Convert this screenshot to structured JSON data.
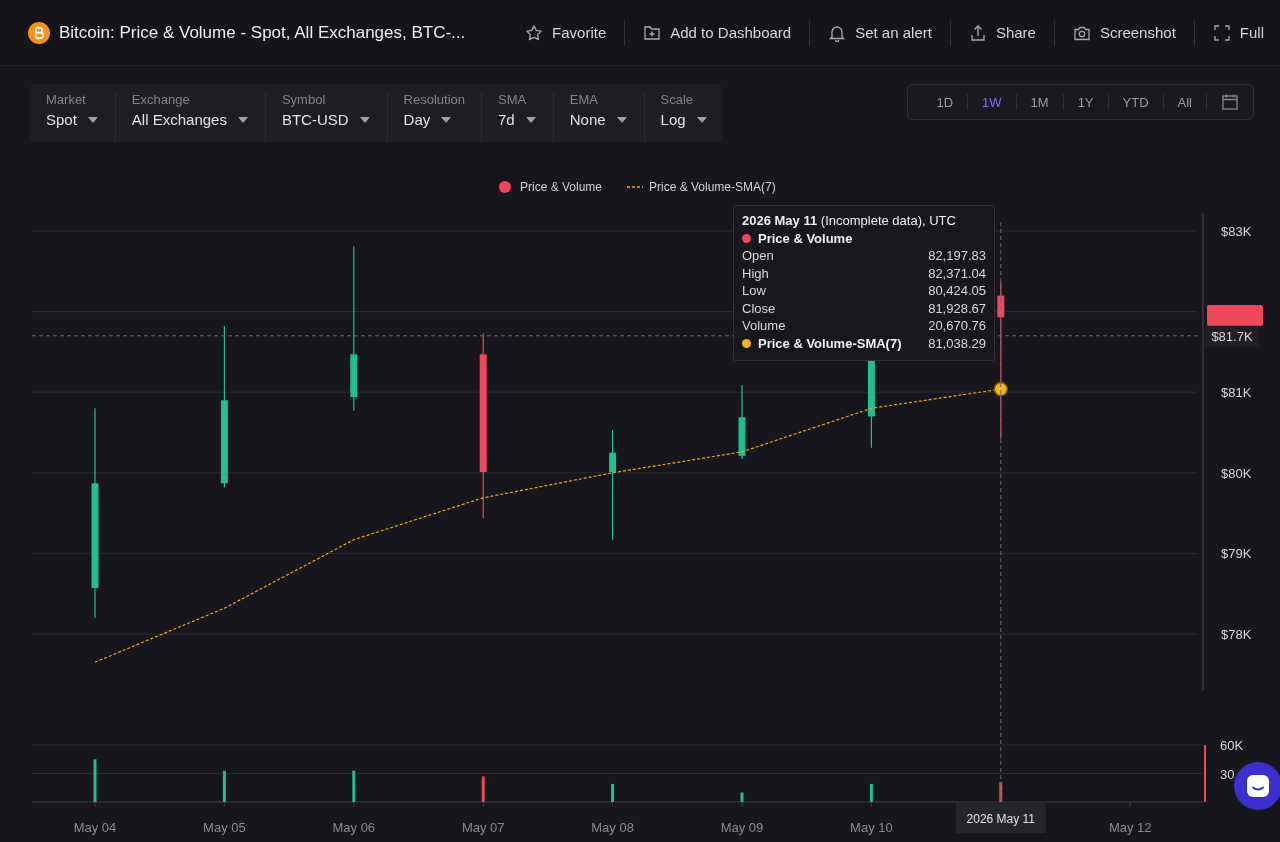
{
  "header": {
    "title": "Bitcoin: Price & Volume - Spot, All Exchanges, BTC-...",
    "actions": [
      {
        "kind": "star",
        "label": "Favorite"
      },
      {
        "kind": "dashboard",
        "label": "Add to Dashboard"
      },
      {
        "kind": "bell",
        "label": "Set an alert"
      },
      {
        "kind": "share",
        "label": "Share"
      },
      {
        "kind": "camera",
        "label": "Screenshot"
      },
      {
        "kind": "expand",
        "label": "Full"
      }
    ]
  },
  "filters": [
    {
      "label": "Market",
      "value": "Spot"
    },
    {
      "label": "Exchange",
      "value": "All Exchanges"
    },
    {
      "label": "Symbol",
      "value": "BTC-USD"
    },
    {
      "label": "Resolution",
      "value": "Day"
    },
    {
      "label": "SMA",
      "value": "7d"
    },
    {
      "label": "EMA",
      "value": "None"
    },
    {
      "label": "Scale",
      "value": "Log"
    }
  ],
  "ranges": [
    {
      "label": "1D",
      "selected": false
    },
    {
      "label": "1W",
      "selected": true
    },
    {
      "label": "1M",
      "selected": false
    },
    {
      "label": "1Y",
      "selected": false
    },
    {
      "label": "YTD",
      "selected": false
    },
    {
      "label": "All",
      "selected": false
    }
  ],
  "price_chart": {
    "chart_data": {
      "type": "candlestick",
      "ylim": [
        77300,
        83200
      ],
      "grid": true,
      "legend": "top",
      "yticks": [
        {
          "value": 83000,
          "label": "$83K"
        },
        {
          "value": 81000,
          "label": "$81K"
        },
        {
          "value": 80000,
          "label": "$80K"
        },
        {
          "value": 79000,
          "label": "$79K"
        },
        {
          "value": 78000,
          "label": "$78K"
        }
      ],
      "series": [
        {
          "name": "Price & Volume",
          "ohlc": [
            [
              78570,
              80800,
              78200,
              79870
            ],
            [
              79870,
              81820,
              79820,
              80900
            ],
            [
              80940,
              82810,
              80770,
              81470
            ],
            [
              81470,
              81730,
              79440,
              80010
            ],
            [
              80010,
              80530,
              79170,
              80250
            ],
            [
              80210,
              81090,
              80170,
              80690
            ],
            [
              80700,
              81400,
              80310,
              81400
            ],
            [
              82197.83,
              82371.04,
              80424.05,
              81928.67
            ],
            null
          ]
        },
        {
          "name": "Price & Volume-SMA(7)",
          "type": "line",
          "line_style": "dashed",
          "color": "#f5a623",
          "values": [
            77650,
            78320,
            79170,
            79690,
            80000,
            80260,
            80800,
            81038.29,
            null
          ]
        }
      ]
    },
    "crosshair": {
      "x_label": "2026 May 11",
      "y_label": "$81.7K"
    }
  },
  "volume_chart": {
    "chart_data": {
      "type": "bar",
      "categories": [
        "May 04",
        "May 05",
        "May 06",
        "May 07",
        "May 08",
        "May 09",
        "May 10",
        null,
        "May 12"
      ],
      "ylim": [
        0,
        60
      ],
      "yticks": [
        {
          "value": 60,
          "label": "60K"
        },
        {
          "value": 30,
          "label": "30"
        }
      ],
      "values": [
        45,
        33,
        33,
        27,
        19,
        10,
        19,
        21,
        null
      ]
    }
  },
  "tooltip": {
    "title": "**2026 May 11** (Incomplete data), UTC",
    "groups": [
      {
        "name": "Price & Volume",
        "color": "#f0475a",
        "rows": [
          {
            "label": "Open",
            "value": "82,197.83"
          },
          {
            "label": "High",
            "value": "82,371.04"
          },
          {
            "label": "Low",
            "value": "80,424.05"
          },
          {
            "label": "Close",
            "value": "81,928.67"
          },
          {
            "label": "Volume",
            "value": "20,670.76"
          }
        ]
      },
      {
        "name": "Price & Volume-SMA(7)",
        "color": "#f5b51c",
        "value": "81,038.29"
      }
    ]
  }
}
